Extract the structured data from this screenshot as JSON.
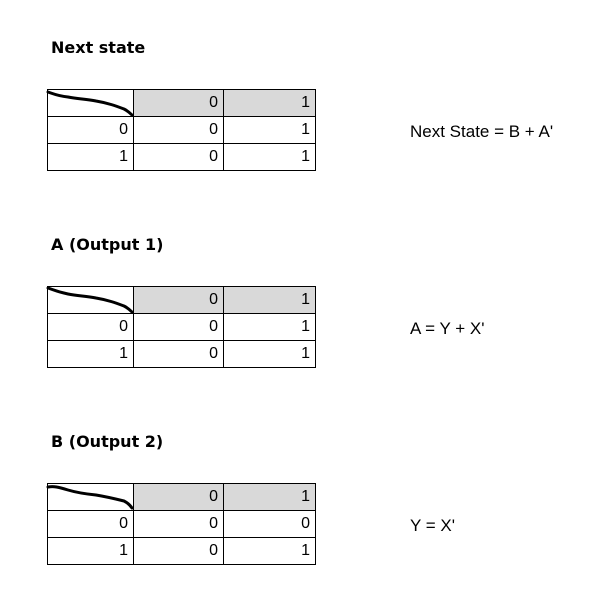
{
  "sections": [
    {
      "title": "Next state",
      "col_headers": [
        "0",
        "1"
      ],
      "rows": [
        {
          "label": "0",
          "cells": [
            "0",
            "1"
          ]
        },
        {
          "label": "1",
          "cells": [
            "0",
            "1"
          ]
        }
      ],
      "equation": "Next State = B + A'"
    },
    {
      "title": "A (Output 1)",
      "col_headers": [
        "0",
        "1"
      ],
      "rows": [
        {
          "label": "0",
          "cells": [
            "0",
            "1"
          ]
        },
        {
          "label": "1",
          "cells": [
            "0",
            "1"
          ]
        }
      ],
      "equation": "A = Y + X'"
    },
    {
      "title": "B (Output 2)",
      "col_headers": [
        "0",
        "1"
      ],
      "rows": [
        {
          "label": "0",
          "cells": [
            "0",
            "0"
          ]
        },
        {
          "label": "1",
          "cells": [
            "0",
            "1"
          ]
        }
      ],
      "equation": "Y = X'"
    }
  ],
  "colors": {
    "header_fill": "#d9d9d9",
    "grid": "#000000"
  }
}
